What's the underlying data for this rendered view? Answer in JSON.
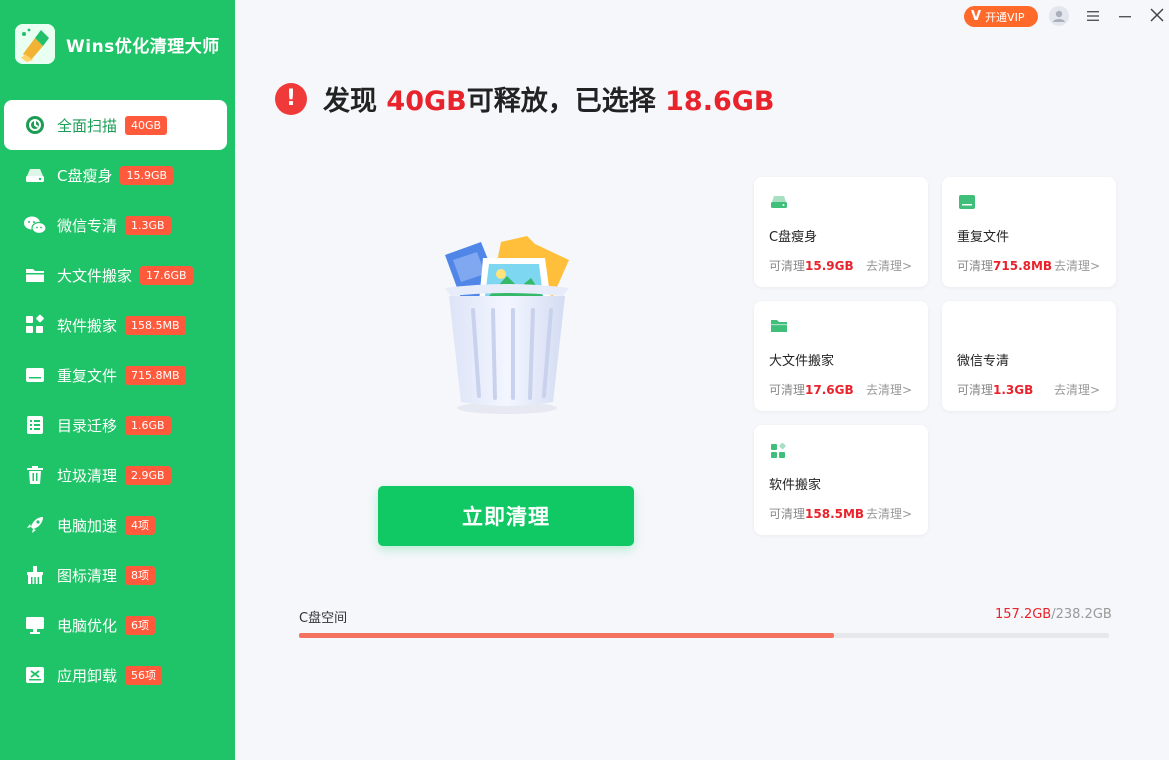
{
  "app": {
    "title": "Wins优化清理大师"
  },
  "titlebar": {
    "vip_v": "V",
    "vip_label": "开通VIP"
  },
  "headline": {
    "prefix": "发现 ",
    "found": "40GB",
    "middle": "可释放，已选择 ",
    "selected": "18.6GB"
  },
  "sidebar": {
    "items": [
      {
        "label": "全面扫描",
        "badge": "40GB",
        "icon": "scan-icon",
        "active": true
      },
      {
        "label": "C盘瘦身",
        "badge": "15.9GB",
        "icon": "drive-icon"
      },
      {
        "label": "微信专清",
        "badge": "1.3GB",
        "icon": "wechat-icon"
      },
      {
        "label": "大文件搬家",
        "badge": "17.6GB",
        "icon": "folder-icon"
      },
      {
        "label": "软件搬家",
        "badge": "158.5MB",
        "icon": "apps-icon"
      },
      {
        "label": "重复文件",
        "badge": "715.8MB",
        "icon": "duplicate-icon"
      },
      {
        "label": "目录迁移",
        "badge": "1.6GB",
        "icon": "list-icon"
      },
      {
        "label": "垃圾清理",
        "badge": "2.9GB",
        "icon": "trash-icon"
      },
      {
        "label": "电脑加速",
        "badge": "4项",
        "icon": "rocket-icon"
      },
      {
        "label": "图标清理",
        "badge": "8项",
        "icon": "brush-icon"
      },
      {
        "label": "电脑优化",
        "badge": "6项",
        "icon": "monitor-icon"
      },
      {
        "label": "应用卸载",
        "badge": "56项",
        "icon": "uninstall-icon"
      }
    ]
  },
  "main": {
    "clean_button": "立即清理"
  },
  "cards": [
    {
      "title": "C盘瘦身",
      "prefix": "可清理",
      "amount": "15.9GB",
      "link": "去清理>"
    },
    {
      "title": "重复文件",
      "prefix": "可清理",
      "amount": "715.8MB",
      "link": "去清理>"
    },
    {
      "title": "大文件搬家",
      "prefix": "可清理",
      "amount": "17.6GB",
      "link": "去清理>"
    },
    {
      "title": "微信专清",
      "prefix": "可清理",
      "amount": "1.3GB",
      "link": "去清理>"
    },
    {
      "title": "软件搬家",
      "prefix": "可清理",
      "amount": "158.5MB",
      "link": "去清理>"
    }
  ],
  "disk": {
    "label": "C盘空间",
    "used": "157.2GB",
    "total": "/238.2GB",
    "used_fraction": 0.66
  },
  "colors": {
    "sidebar": "#20c468",
    "accent_red": "#e8232b",
    "badge": "#ff5a3c",
    "button": "#10c964",
    "vip": "#ff6a2b"
  }
}
